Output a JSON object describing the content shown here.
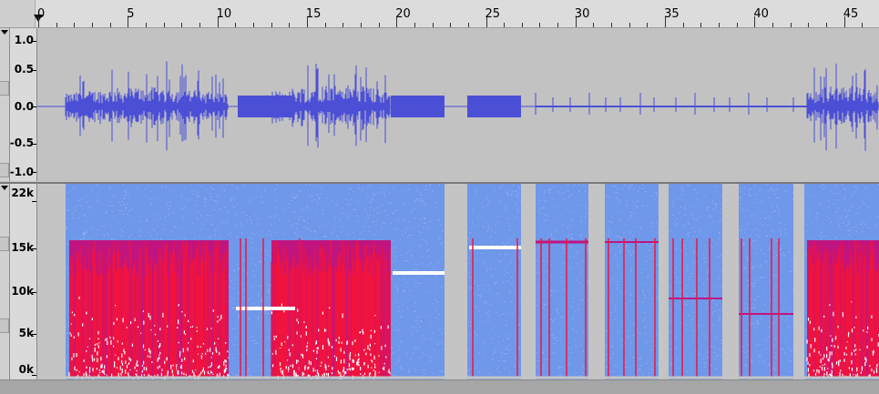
{
  "timeline": {
    "ticks": [
      "0",
      "5",
      "10",
      "15",
      "20",
      "25",
      "30",
      "35",
      "40",
      "45"
    ]
  },
  "waveform_track": {
    "labels": [
      "1.0",
      "0.5",
      "0.0",
      "-0.5",
      "-1.0"
    ]
  },
  "spectrogram_track": {
    "labels": [
      "22k",
      "15k",
      "10k",
      "5k",
      "0k"
    ]
  },
  "colors": {
    "waveform": "#4b4fd6",
    "waveform_bg": "#c2c2c2",
    "spectrogram_bg": "#6f97ea",
    "energy_red": "#f0133d",
    "energy_magenta": "#c0157f",
    "tone_white": "#ffffff"
  }
}
